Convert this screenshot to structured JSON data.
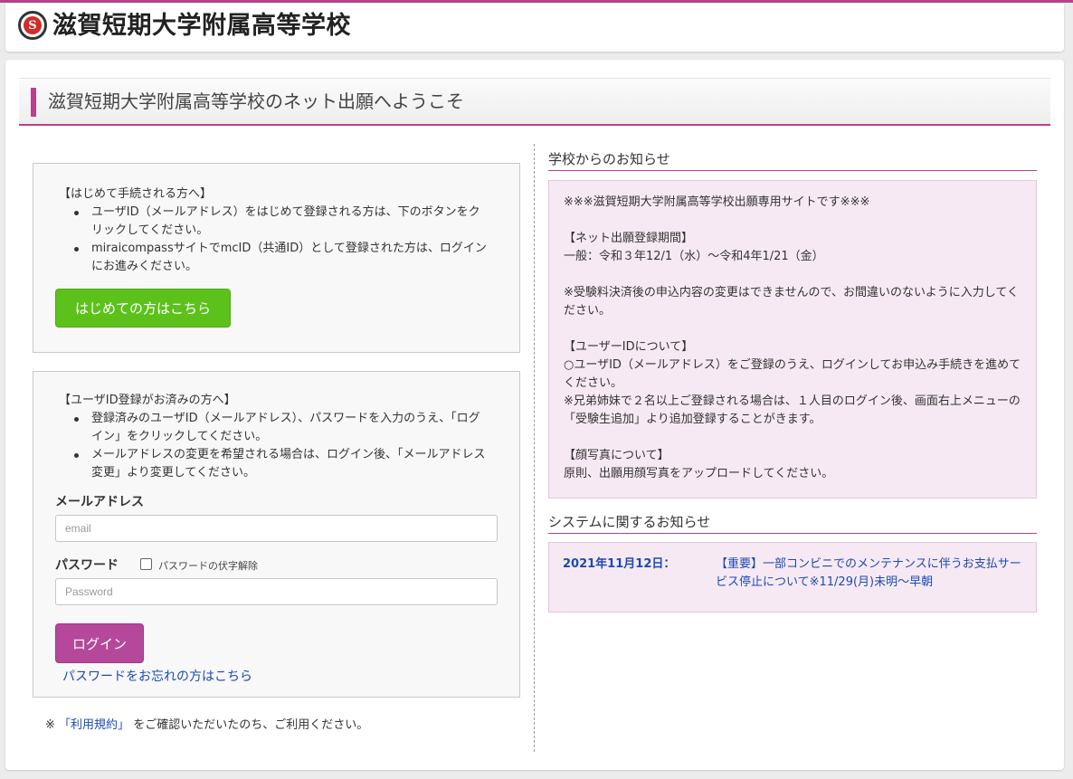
{
  "header": {
    "emblem_letter": "S",
    "school_name": "滋賀短期大学附属高等学校"
  },
  "page": {
    "title": "滋賀短期大学附属高等学校のネット出願へようこそ"
  },
  "first_time": {
    "lead": "【はじめて手続される方へ】",
    "bullets": [
      "ユーザID（メールアドレス）をはじめて登録される方は、下のボタンをクリックしてください。",
      "miraicompassサイトでmcID（共通ID）として登録された方は、ログインにお進みください。"
    ],
    "button_label": "はじめての方はこちら"
  },
  "login": {
    "lead": "【ユーザID登録がお済みの方へ】",
    "bullets": [
      "登録済みのユーザID（メールアドレス）、パスワードを入力のうえ、「ログイン」をクリックしてください。",
      "メールアドレスの変更を希望される場合は、ログイン後、「メールアドレス変更」より変更してください。"
    ],
    "email_label": "メールアドレス",
    "email_placeholder": "email",
    "password_label": "パスワード",
    "show_password_label": "パスワードの伏字解除",
    "password_placeholder": "Password",
    "login_button": "ログイン",
    "forgot_link": "パスワードをお忘れの方はこちら"
  },
  "terms": {
    "prefix": "※",
    "link": "「利用規約」",
    "suffix": "をご確認いただいたのち、ご利用ください。"
  },
  "school_notice": {
    "title": "学校からのお知らせ",
    "body": "※※※滋賀短期大学附属高等学校出願専用サイトです※※※\n\n【ネット出願登録期間】\n一般：令和３年12/1（水）～令和4年1/21（金）\n\n※受験料決済後の申込内容の変更はできませんので、お間違いのないように入力してください。\n\n【ユーザーIDについて】\n○ユーザID（メールアドレス）をご登録のうえ、ログインしてお申込み手続きを進めてください。\n※兄弟姉妹で２名以上ご登録される場合は、１人目のログイン後、画面右上メニューの「受験生追加」より追加登録することがきます。\n\n【顔写真について】\n原則、出願用顔写真をアップロードしてください。"
  },
  "system_notice": {
    "title": "システムに関するお知らせ",
    "date": "2021年11月12日：",
    "link": "【重要】一部コンビニでのメンテナンスに伴うお支払サービス停止について※11/29(月)未明～早朝"
  },
  "colors": {
    "accent": "#b8408f",
    "green_button": "#5cc21b",
    "login_button": "#b5489b",
    "notice_bg": "#f7e9f3",
    "link": "#1a4bb3"
  }
}
